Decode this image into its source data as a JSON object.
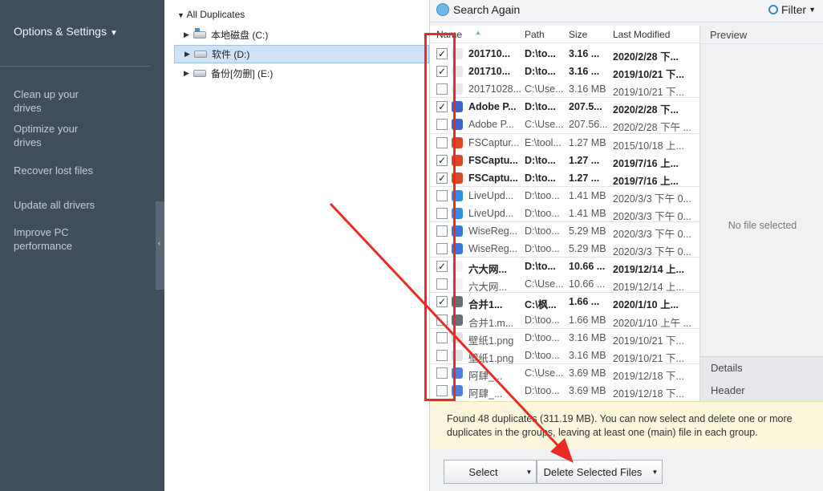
{
  "sidebar": {
    "options_label": "Options & Settings",
    "items": [
      {
        "label": "Clean up your drives"
      },
      {
        "label": "Optimize your drives"
      },
      {
        "label": "Recover lost files"
      },
      {
        "label": "Update all drivers"
      },
      {
        "label": "Improve PC performance"
      }
    ],
    "collapse_glyph": "‹"
  },
  "tree": {
    "root_label": "All Duplicates",
    "nodes": [
      {
        "label": "本地磁盘 (C:)",
        "icon": "windows-drive-icon"
      },
      {
        "label": "软件 (D:)",
        "icon": "drive-icon",
        "selected": true
      },
      {
        "label": "备份[勿删] (E:)",
        "icon": "drive-icon"
      }
    ]
  },
  "toolbar": {
    "search_again": "Search Again",
    "filter": "Filter"
  },
  "columns": {
    "name": "Name",
    "path": "Path",
    "size": "Size",
    "modified": "Last Modified"
  },
  "files": [
    {
      "checked": true,
      "name": "201710...",
      "path": "D:\\to...",
      "size": "3.16 ...",
      "modified": "2020/2/28 下...",
      "bold": true,
      "color": "#e8e8e8"
    },
    {
      "checked": true,
      "name": "201710...",
      "path": "D:\\to...",
      "size": "3.16 ...",
      "modified": "2019/10/21 下...",
      "bold": true,
      "color": "#e8e8e8"
    },
    {
      "checked": false,
      "name": "20171028...",
      "path": "C:\\Use...",
      "size": "3.16 MB",
      "modified": "2019/10/21 下...",
      "bold": false,
      "color": "#e8e8e8"
    },
    {
      "checked": true,
      "name": "Adobe P...",
      "path": "D:\\to...",
      "size": "207.5...",
      "modified": "2020/2/28 下...",
      "bold": true,
      "color": "#3b63c8"
    },
    {
      "checked": false,
      "name": "Adobe P...",
      "path": "C:\\Use...",
      "size": "207.56...",
      "modified": "2020/2/28 下午 ...",
      "bold": false,
      "color": "#3b63c8"
    },
    {
      "checked": false,
      "name": "FSCaptur...",
      "path": "E:\\tool...",
      "size": "1.27 MB",
      "modified": "2015/10/18 上...",
      "bold": false,
      "color": "#d84a2a"
    },
    {
      "checked": true,
      "name": "FSCaptu...",
      "path": "D:\\to...",
      "size": "1.27 ...",
      "modified": "2019/7/16 上...",
      "bold": true,
      "color": "#d84a2a"
    },
    {
      "checked": true,
      "name": "FSCaptu...",
      "path": "D:\\to...",
      "size": "1.27 ...",
      "modified": "2019/7/16 上...",
      "bold": true,
      "color": "#d84a2a"
    },
    {
      "checked": false,
      "name": "LiveUpd...",
      "path": "D:\\too...",
      "size": "1.41 MB",
      "modified": "2020/3/3 下午 0...",
      "bold": false,
      "color": "#2f8fe0"
    },
    {
      "checked": false,
      "name": "LiveUpd...",
      "path": "D:\\too...",
      "size": "1.41 MB",
      "modified": "2020/3/3 下午 0...",
      "bold": false,
      "color": "#2f8fe0"
    },
    {
      "checked": false,
      "name": "WiseReg...",
      "path": "D:\\too...",
      "size": "5.29 MB",
      "modified": "2020/3/3 下午 0...",
      "bold": false,
      "color": "#3b76d6"
    },
    {
      "checked": false,
      "name": "WiseReg...",
      "path": "D:\\too...",
      "size": "5.29 MB",
      "modified": "2020/3/3 下午 0...",
      "bold": false,
      "color": "#3b76d6"
    },
    {
      "checked": true,
      "name": "六大网...",
      "path": "D:\\to...",
      "size": "10.66 ...",
      "modified": "2019/12/14 上...",
      "bold": true,
      "color": "#f2f2f2"
    },
    {
      "checked": false,
      "name": "六大网...",
      "path": "C:\\Use...",
      "size": "10.66 ...",
      "modified": "2019/12/14 上...",
      "bold": false,
      "color": "#f2f2f2"
    },
    {
      "checked": true,
      "name": "合并1...",
      "path": "C:\\枫...",
      "size": "1.66 ...",
      "modified": "2020/1/10 上...",
      "bold": true,
      "color": "#6a6f76"
    },
    {
      "checked": false,
      "name": "合并1.m...",
      "path": "D:\\too...",
      "size": "1.66 MB",
      "modified": "2020/1/10 上午 ...",
      "bold": false,
      "color": "#6a6f76"
    },
    {
      "checked": false,
      "name": "壁纸1.png",
      "path": "D:\\too...",
      "size": "3.16 MB",
      "modified": "2019/10/21 下...",
      "bold": false,
      "color": "#e0e0e0"
    },
    {
      "checked": false,
      "name": "壁纸1.png",
      "path": "D:\\too...",
      "size": "3.16 MB",
      "modified": "2019/10/21 下...",
      "bold": false,
      "color": "#e0e0e0"
    },
    {
      "checked": false,
      "name": "阿肆_...",
      "path": "C:\\Use...",
      "size": "3.69 MB",
      "modified": "2019/12/18 下...",
      "bold": false,
      "color": "#4f7fd6"
    },
    {
      "checked": false,
      "name": "阿肆_...",
      "path": "D:\\too...",
      "size": "3.69 MB",
      "modified": "2019/12/18 下...",
      "bold": false,
      "color": "#4f7fd6"
    }
  ],
  "group_sizes": [
    3,
    2,
    3,
    2,
    2,
    2,
    2,
    2,
    2
  ],
  "preview": {
    "title": "Preview",
    "empty": "No file selected",
    "details": "Details",
    "header": "Header"
  },
  "summary": "Found 48 duplicates (311.19 MB). You can now select and delete one or more duplicates in the groups, leaving at least one (main) file in each group.",
  "buttons": {
    "select": "Select",
    "delete": "Delete Selected Files"
  }
}
